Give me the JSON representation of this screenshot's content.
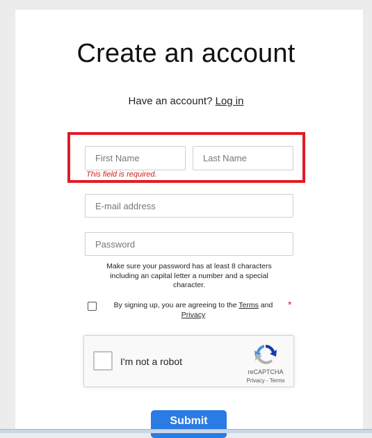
{
  "page": {
    "title": "Create an account",
    "have_account_text": "Have an account?",
    "login_link": "Log in"
  },
  "form": {
    "first_name": {
      "value": "",
      "placeholder": "First Name"
    },
    "last_name": {
      "value": "",
      "placeholder": "Last Name"
    },
    "error_message": "This field is required.",
    "email": {
      "value": "",
      "placeholder": "E-mail address"
    },
    "password": {
      "value": "",
      "placeholder": "Password"
    },
    "password_hint": "Make sure your password has at least 8 characters including an capital letter a number and a special character.",
    "terms": {
      "prefix": "By signing up, you are agreeing to the",
      "terms_link": "Terms",
      "and": "and",
      "privacy_link": "Privacy",
      "required_mark": "*",
      "checked": false
    },
    "submit_label": "Submit"
  },
  "recaptcha": {
    "label": "I'm not a robot",
    "brand": "reCAPTCHA",
    "links": "Privacy - Terms",
    "checked": false
  },
  "colors": {
    "accent": "#2a7be4",
    "error": "#d32020",
    "highlight_border": "#e01b24",
    "background": "#ececec"
  }
}
